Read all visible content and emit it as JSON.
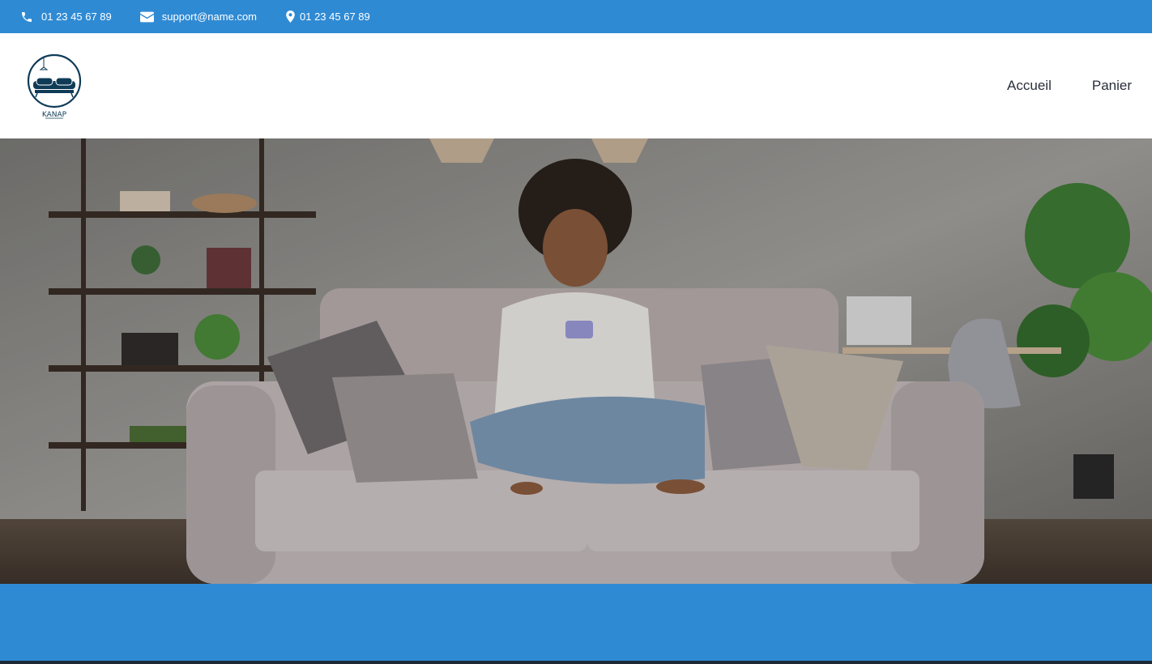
{
  "topbar": {
    "phone": "01 23 45 67 89",
    "email": "support@name.com",
    "location": "01 23 45 67 89",
    "icons": [
      "phone-icon",
      "envelope-icon",
      "map-pin-icon"
    ],
    "background": "#2f8ad4"
  },
  "header": {
    "logo_text": "KANAP",
    "nav": [
      {
        "label": "Accueil"
      },
      {
        "label": "Panier"
      }
    ]
  },
  "hero": {
    "image": "woman-on-sofa-photo"
  },
  "colors": {
    "brand_blue": "#2f8ad4",
    "logo_dark": "#0f3b57",
    "nav_text": "#2a2f3a"
  }
}
